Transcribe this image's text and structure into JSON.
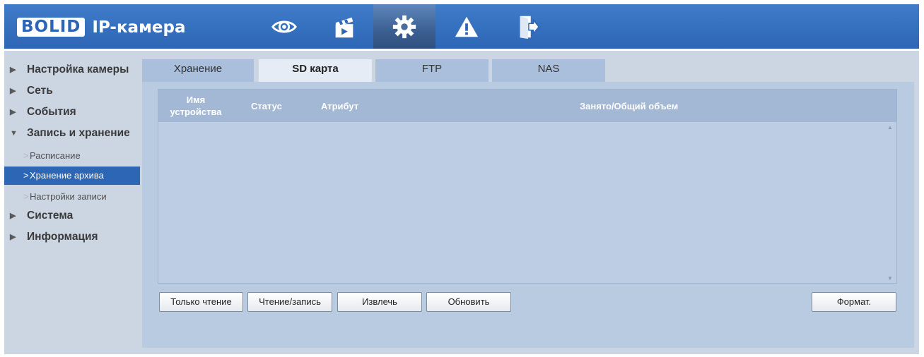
{
  "header": {
    "logo_brand": "BOLID",
    "logo_title": "IP-камера",
    "nav": [
      {
        "name": "live-view",
        "icon": "eye-icon",
        "active": false
      },
      {
        "name": "playback",
        "icon": "clapperboard-icon",
        "active": false
      },
      {
        "name": "settings",
        "icon": "gear-icon",
        "active": true
      },
      {
        "name": "alarm",
        "icon": "warning-icon",
        "active": false
      },
      {
        "name": "logout",
        "icon": "exit-icon",
        "active": false
      }
    ]
  },
  "sidebar": {
    "items": [
      {
        "label": "Настройка камеры",
        "arrow": "▶"
      },
      {
        "label": "Сеть",
        "arrow": "▶"
      },
      {
        "label": "События",
        "arrow": "▶"
      },
      {
        "label": "Запись и хранение",
        "arrow": "▼"
      },
      {
        "label": "Система",
        "arrow": "▶"
      },
      {
        "label": "Информация",
        "arrow": "▶"
      }
    ],
    "subitems": [
      {
        "label": "Расписание",
        "chevron": ">"
      },
      {
        "label": "Хранение архива",
        "chevron": ">",
        "active": true
      },
      {
        "label": "Настройки записи",
        "chevron": ">"
      }
    ]
  },
  "tabs": [
    {
      "label": "Хранение"
    },
    {
      "label": "SD карта",
      "active": true
    },
    {
      "label": "FTP"
    },
    {
      "label": "NAS"
    }
  ],
  "table": {
    "columns": {
      "name_line1": "Имя",
      "name_line2": "устройства",
      "status": "Статус",
      "attribute": "Атрибут",
      "usage": "Занято/Общий объем"
    },
    "rows": [],
    "scroll_up": "▲",
    "scroll_down": "▼"
  },
  "buttons": {
    "read_only": "Только чтение",
    "read_write": "Чтение/запись",
    "eject": "Извлечь",
    "refresh": "Обновить",
    "format": "Формат."
  },
  "colors": {
    "header": "#3f7cc9",
    "accent": "#2d66b4",
    "background": "#ccd5e2",
    "panel": "#b9cbe1"
  }
}
